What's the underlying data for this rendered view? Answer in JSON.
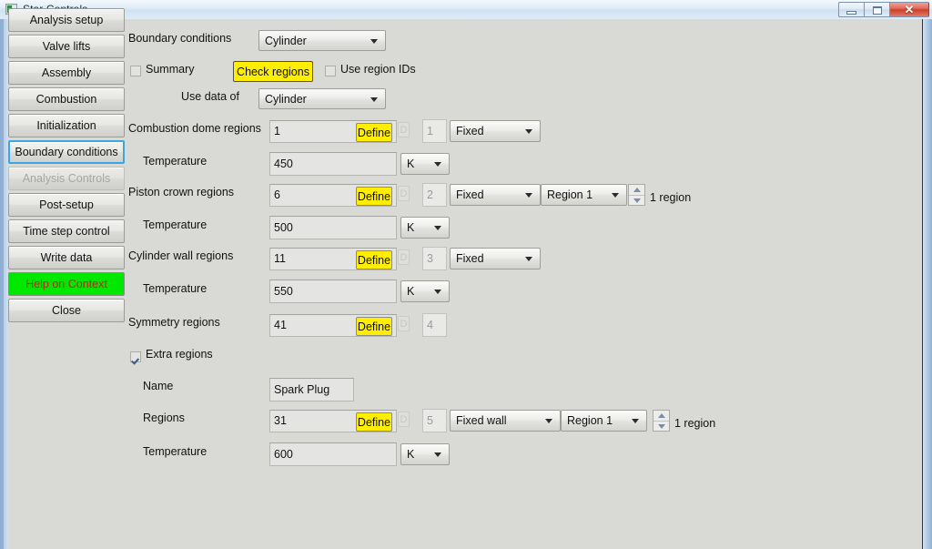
{
  "window": {
    "title": "Star Controls",
    "icon": "app-icon",
    "controls": {
      "minimize": "minimize-icon",
      "maximize": "maximize-icon",
      "close": "✕"
    }
  },
  "sidebar": {
    "items": [
      {
        "label": "Analysis setup",
        "state": "normal"
      },
      {
        "label": "Valve lifts",
        "state": "normal"
      },
      {
        "label": "Assembly",
        "state": "normal"
      },
      {
        "label": "Combustion",
        "state": "normal"
      },
      {
        "label": "Initialization",
        "state": "normal"
      },
      {
        "label": "Boundary conditions",
        "state": "focused"
      },
      {
        "label": "Analysis Controls",
        "state": "disabled"
      },
      {
        "label": "Post-setup",
        "state": "normal"
      },
      {
        "label": "Time step control",
        "state": "normal"
      },
      {
        "label": "Write data",
        "state": "normal"
      },
      {
        "label": "Help on Context",
        "state": "help"
      },
      {
        "label": "Close",
        "state": "normal"
      }
    ]
  },
  "form": {
    "header": {
      "boundary_conditions_label": "Boundary conditions",
      "boundary_conditions_value": "Cylinder",
      "summary_label": "Summary",
      "summary_checked": false,
      "check_regions_button": "Check regions",
      "use_region_ids_label": "Use region IDs",
      "use_region_ids_checked": false,
      "use_data_of_label": "Use data of",
      "use_data_of_value": "Cylinder"
    },
    "rows": [
      {
        "label": "Combustion dome regions",
        "count": "1",
        "define_button": "Define",
        "ghost_button": "D",
        "index": "1",
        "type_value": "Fixed",
        "region_value": null,
        "region_count_text": null,
        "temperature_label": "Temperature",
        "temperature_value": "450",
        "temperature_unit": "K"
      },
      {
        "label": "Piston crown regions",
        "count": "6",
        "define_button": "Define",
        "ghost_button": "D",
        "index": "2",
        "type_value": "Fixed",
        "region_value": "Region 1",
        "region_count_text": "1 region",
        "temperature_label": "Temperature",
        "temperature_value": "500",
        "temperature_unit": "K"
      },
      {
        "label": "Cylinder wall regions",
        "count": "11",
        "define_button": "Define",
        "ghost_button": "D",
        "index": "3",
        "type_value": "Fixed",
        "region_value": null,
        "region_count_text": null,
        "temperature_label": "Temperature",
        "temperature_value": "550",
        "temperature_unit": "K"
      },
      {
        "label": "Symmetry regions",
        "count": "41",
        "define_button": "Define",
        "ghost_button": "D",
        "index": "4",
        "type_value": null,
        "region_value": null,
        "region_count_text": null,
        "temperature_label": null,
        "temperature_value": null,
        "temperature_unit": null
      }
    ],
    "extra": {
      "checkbox_label": "Extra regions",
      "checked": true,
      "name_label": "Name",
      "name_value": "Spark Plug",
      "regions_label": "Regions",
      "regions_count": "31",
      "define_button": "Define",
      "ghost_button": "D",
      "index": "5",
      "type_value": "Fixed wall",
      "region_value": "Region 1",
      "region_count_text": "1 region",
      "temperature_label": "Temperature",
      "temperature_value": "600",
      "temperature_unit": "K"
    }
  },
  "colors": {
    "accent_yellow": "#ffee00",
    "help_green": "#00e800",
    "help_text_red": "#c02020",
    "focus_blue": "#3aa7e0",
    "panel_gray": "#d9d9d6"
  }
}
